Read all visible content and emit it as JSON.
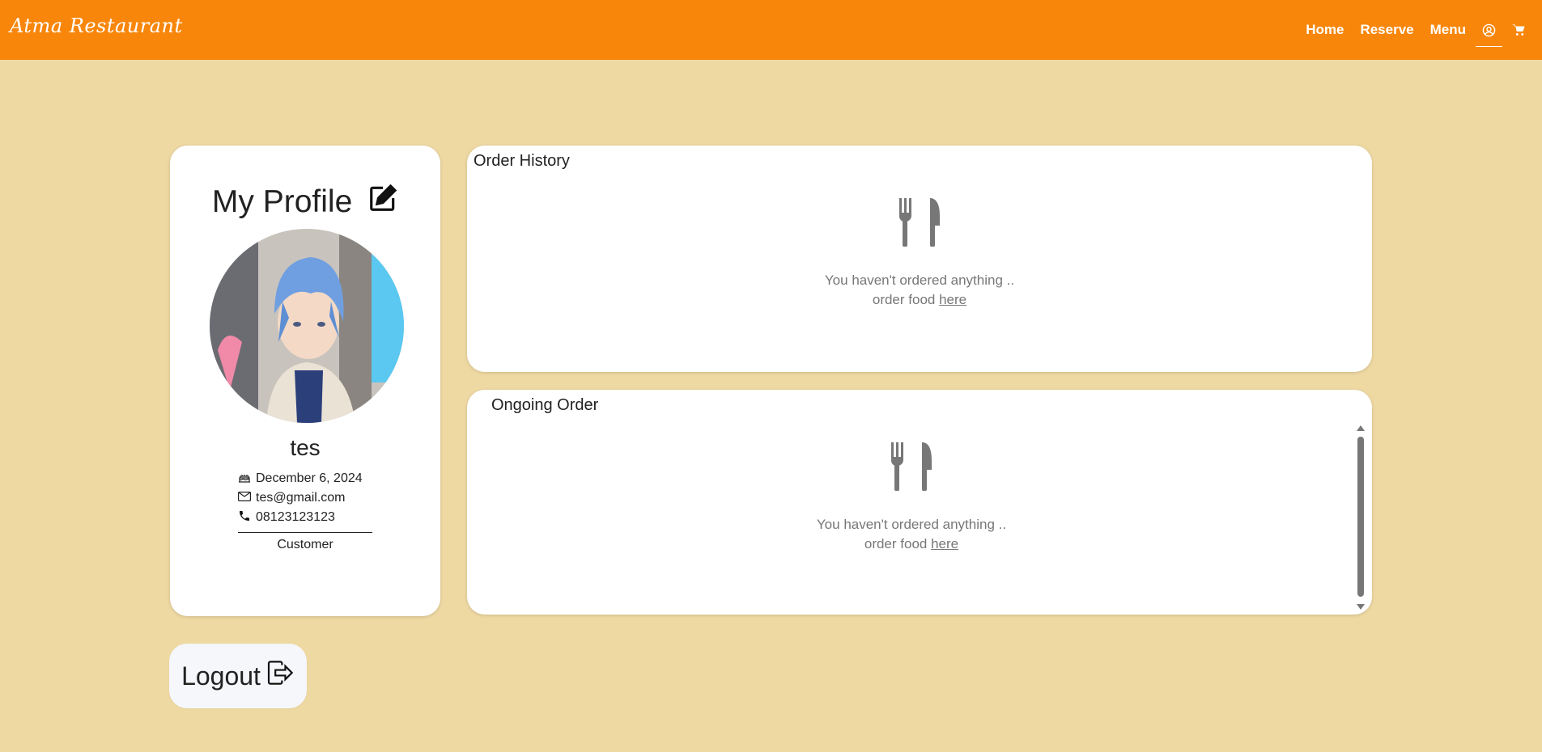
{
  "navbar": {
    "brand": "Atma Restaurant",
    "links": [
      "Home",
      "Reserve",
      "Menu"
    ],
    "icons": [
      "user-circle-icon",
      "cart-icon"
    ],
    "background": "#f7860a"
  },
  "profile": {
    "title": "My Profile",
    "username": "tes",
    "birthday": "December 6, 2024",
    "email": "tes@gmail.com",
    "phone": "08123123123",
    "role": "Customer"
  },
  "order_history": {
    "title": "Order History",
    "empty_text": "You haven't ordered anything ..",
    "order_prefix": "order food",
    "order_link": "here"
  },
  "ongoing_order": {
    "title": "Ongoing Order",
    "empty_text": "You haven't ordered anything ..",
    "order_prefix": "order food",
    "order_link": "here"
  },
  "logout": {
    "label": "Logout"
  },
  "colors": {
    "page_bg": "#efd9a3",
    "accent": "#f7860a",
    "muted": "#777777"
  }
}
